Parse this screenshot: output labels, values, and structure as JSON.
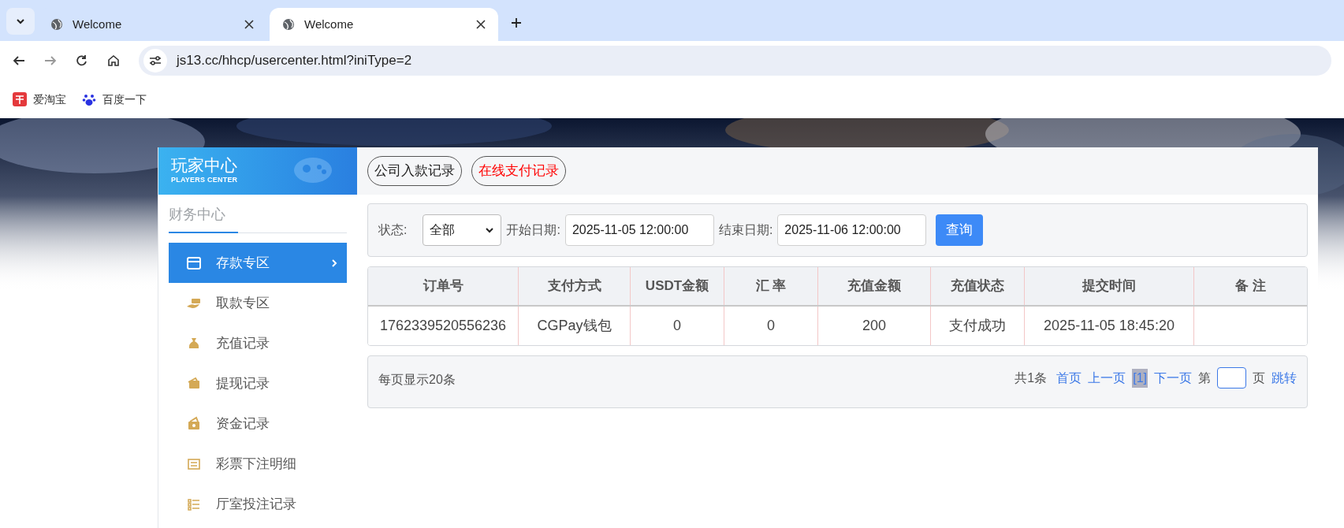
{
  "browser": {
    "tabs": [
      {
        "title": "Welcome",
        "selected": false
      },
      {
        "title": "Welcome",
        "selected": true
      }
    ],
    "url": "js13.cc/hhcp/usercenter.html?iniType=2",
    "bookmarks": [
      {
        "label": "爱淘宝",
        "kind": "taobao"
      },
      {
        "label": "百度一下",
        "kind": "baidu"
      }
    ]
  },
  "sidebar": {
    "title": "玩家中心",
    "subtitle": "PLAYERS CENTER",
    "section": "财务中心",
    "items": [
      {
        "label": "存款专区",
        "selected": true
      },
      {
        "label": "取款专区",
        "selected": false
      },
      {
        "label": "充值记录",
        "selected": false
      },
      {
        "label": "提现记录",
        "selected": false
      },
      {
        "label": "资金记录",
        "selected": false
      },
      {
        "label": "彩票下注明细",
        "selected": false
      },
      {
        "label": "厅室投注记录",
        "selected": false
      }
    ]
  },
  "record_tabs": [
    {
      "label": "公司入款记录",
      "selected": false
    },
    {
      "label": "在线支付记录",
      "selected": true
    }
  ],
  "filter": {
    "status_label": "状态:",
    "status_value": "全部",
    "start_label": "开始日期:",
    "start_value": "2025-11-05 12:00:00",
    "end_label": "结束日期:",
    "end_value": "2025-11-06 12:00:00",
    "button": "查询"
  },
  "table": {
    "columns": [
      "订单号",
      "支付方式",
      "USDT金额",
      "汇 率",
      "充值金额",
      "充值状态",
      "提交时间",
      "备 注"
    ],
    "rows": [
      [
        "1762339520556236",
        "CGPay钱包",
        "0",
        "0",
        "200",
        "支付成功",
        "2025-11-05 18:45:20",
        ""
      ]
    ]
  },
  "pagination": {
    "per_page": "每页显示20条",
    "total": "共1条",
    "first": "首页",
    "prev": "上一页",
    "pages": [
      {
        "label": "[1]",
        "selected": true
      }
    ],
    "next": "下一页",
    "goto_prefix": "第",
    "goto_suffix": "页",
    "goto": "跳转"
  }
}
